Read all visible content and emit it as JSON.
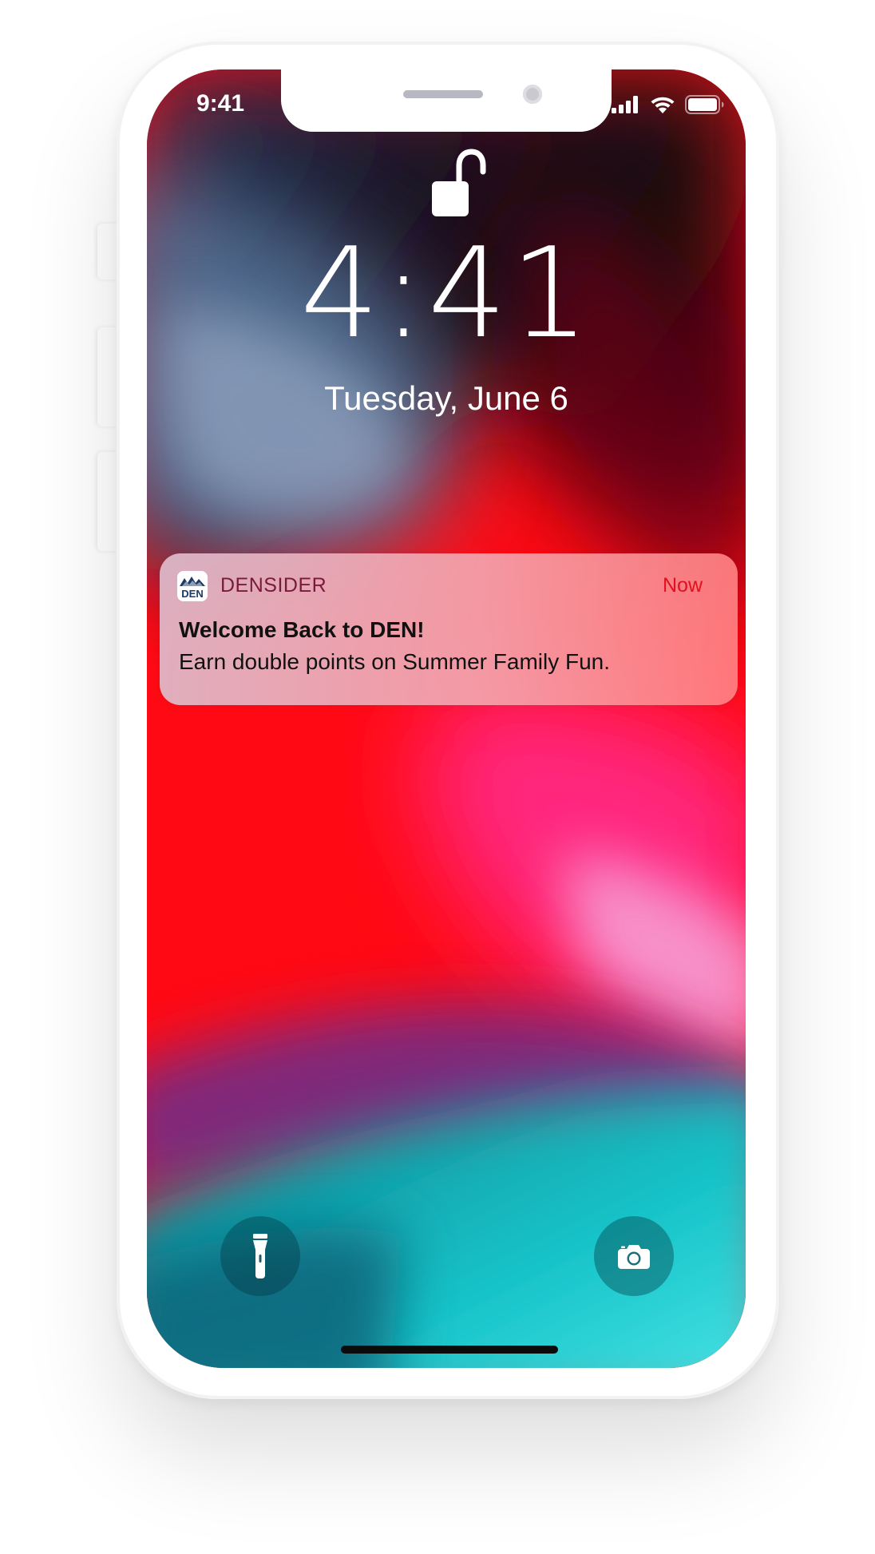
{
  "status_bar": {
    "time": "9:41",
    "icons": [
      "cellular-signal-icon",
      "wifi-icon",
      "battery-icon"
    ]
  },
  "lock_screen": {
    "lock_state_icon": "unlocked-padlock-icon",
    "time": "4:41",
    "date": "Tuesday, June 6"
  },
  "notification": {
    "app_icon_text": "DEN",
    "app_name": "DENSIDER",
    "time": "Now",
    "title": "Welcome Back to DEN!",
    "body": "Earn double points on Summer Family Fun."
  },
  "quick_actions": {
    "left": "flashlight-icon",
    "right": "camera-icon"
  },
  "colors": {
    "notification_time": "#e0101e",
    "app_name": "#7a1a3a",
    "app_icon_navy": "#1b3a67"
  }
}
